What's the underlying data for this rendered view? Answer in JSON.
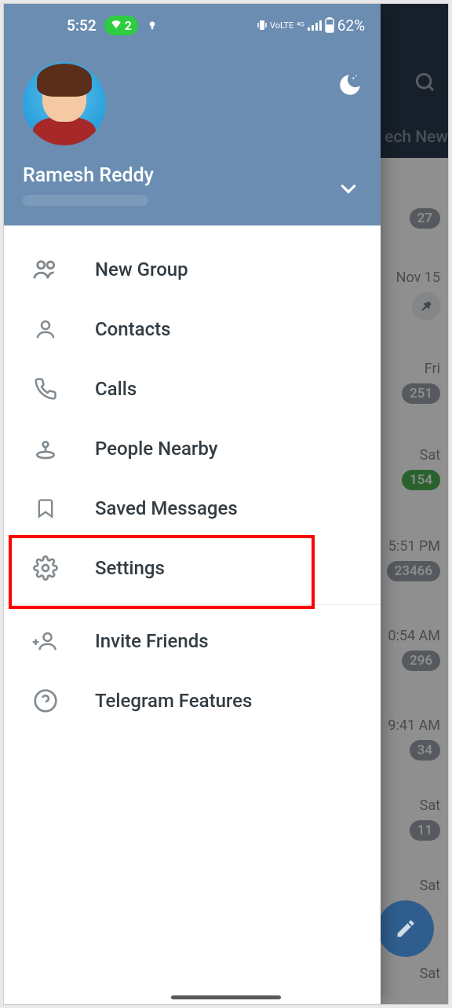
{
  "status": {
    "time": "5:52",
    "wifi_count": "2",
    "battery_pct": "62%",
    "net": "VoLTE",
    "signal": "4G"
  },
  "profile": {
    "name": "Ramesh Reddy"
  },
  "menu": {
    "new_group": "New Group",
    "contacts": "Contacts",
    "calls": "Calls",
    "people_nearby": "People Nearby",
    "saved_messages": "Saved Messages",
    "settings": "Settings",
    "invite_friends": "Invite Friends",
    "telegram_features": "Telegram Features"
  },
  "bg": {
    "tab": "ech New",
    "rows": [
      {
        "badge": "27"
      },
      {
        "time": "Nov 15",
        "pin": true
      },
      {
        "time": "Fri",
        "badge": "251"
      },
      {
        "time": "Sat",
        "badge": "154",
        "green": true
      },
      {
        "time": "5:51 PM",
        "badge": "23466"
      },
      {
        "time": "0:54 AM",
        "badge": "296"
      },
      {
        "time": "9:41 AM",
        "badge": "34"
      },
      {
        "time": "Sat",
        "badge": "11"
      },
      {
        "time": "Sat"
      },
      {
        "time": "Sat"
      }
    ]
  },
  "highlight": "settings"
}
